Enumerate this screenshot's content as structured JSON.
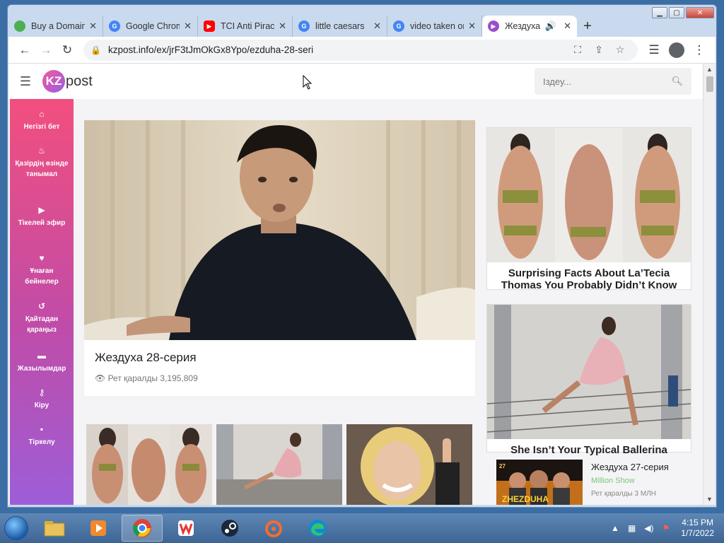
{
  "browser": {
    "tabs": [
      {
        "title": "Buy a Domain",
        "favicon": "green-circle-icon",
        "color": "#4caf50",
        "active": false
      },
      {
        "title": "Google Chrome",
        "favicon": "google-icon",
        "color": "#4285f4",
        "active": false
      },
      {
        "title": "TCI Anti Piracy",
        "favicon": "youtube-icon",
        "color": "#ff0000",
        "active": false
      },
      {
        "title": "little caesars",
        "favicon": "google-icon",
        "color": "#4285f4",
        "active": false
      },
      {
        "title": "video taken on",
        "favicon": "google-icon",
        "color": "#4285f4",
        "active": false
      },
      {
        "title": "Жездуха",
        "favicon": "play-icon",
        "color": "#9c4dcc",
        "active": true
      }
    ],
    "url": "kzpost.info/ex/jrF3tJmOkGx8Ypo/ezduha-28-seri"
  },
  "site": {
    "logo_kz": "KZ",
    "logo_post": "post",
    "search_placeholder": "Іздеу...",
    "sidebar": [
      {
        "icon": "home-icon",
        "glyph": "⌂",
        "label": "Негізгі бет"
      },
      {
        "icon": "fire-icon",
        "glyph": "♨",
        "label": "Қазірдің өзінде танымал"
      },
      {
        "icon": "live-icon",
        "glyph": "▶",
        "label": "Тікелей эфир"
      },
      {
        "icon": "heart-icon",
        "glyph": "♥",
        "label": "Ұнаған бейнелер"
      },
      {
        "icon": "history-icon",
        "glyph": "↺",
        "label": "Қайтадан қараңыз"
      },
      {
        "icon": "folder-icon",
        "glyph": "▬",
        "label": "Жазылымдар"
      },
      {
        "icon": "key-icon",
        "glyph": "⚷",
        "label": "Кіру"
      },
      {
        "icon": "lock-icon",
        "glyph": "▪",
        "label": "Тіркелу"
      }
    ],
    "hero": {
      "title": "Жездуха 28-серия",
      "views": "Рет қаралды 3,195,809"
    },
    "ads": [
      {
        "title": "Surprising Facts About La’Tecia Thomas You Probably Didn’t Know"
      },
      {
        "title": "She Isn’t Your Typical Ballerina"
      }
    ],
    "related": {
      "title": "Жездуха 27-серия",
      "channel": "Million Show",
      "views": "Рет қаралды 3 МЛН",
      "thumb_text": "ZHEZDUHA",
      "thumb_number": "27"
    }
  },
  "taskbar": {
    "time": "4:15 PM",
    "date": "1/7/2022",
    "apps": [
      "explorer-icon",
      "media-player-icon",
      "chrome-icon",
      "wps-icon",
      "steam-icon",
      "origin-icon",
      "edge-icon"
    ]
  }
}
